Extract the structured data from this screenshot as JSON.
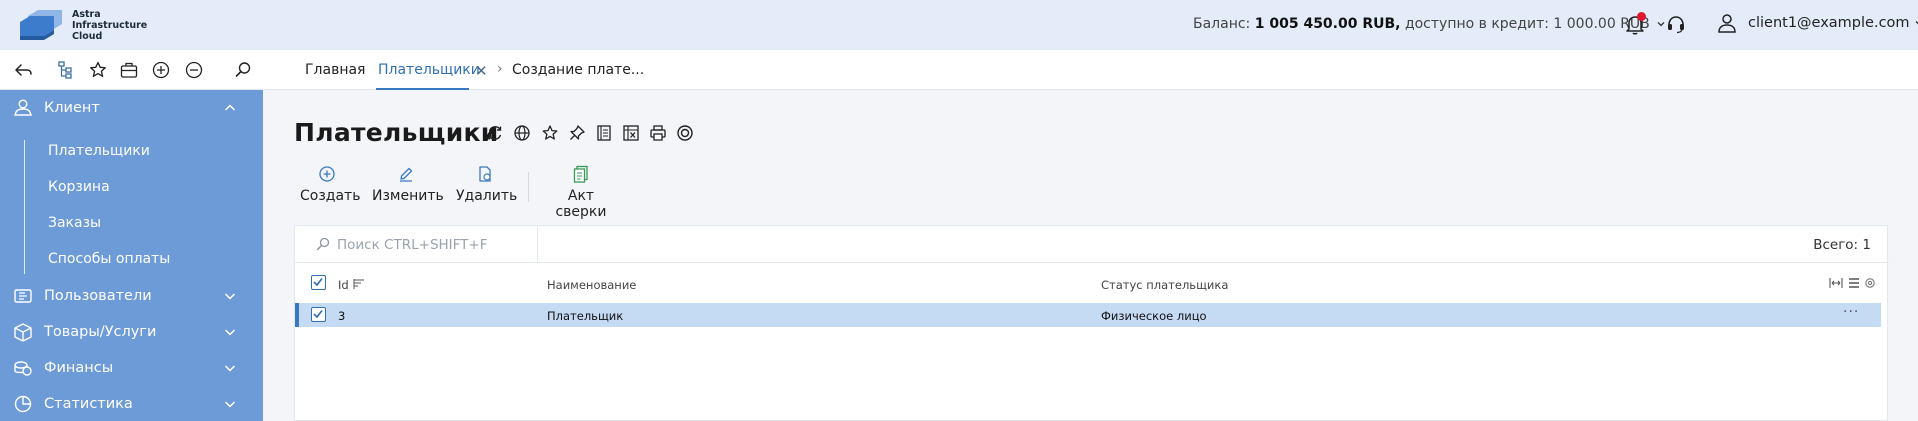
{
  "header": {
    "logo_lines": [
      "Astra",
      "Infrastructure",
      "Cloud"
    ],
    "balance_label": "Баланс:",
    "balance_value": "1 005 450.00 RUB,",
    "credit_label": "доступно в кредит:",
    "credit_value": "1 000.00 RUB",
    "user_email": "client1@example.com"
  },
  "toolbar": {
    "tabs": [
      {
        "label": "Главная"
      },
      {
        "label": "Плательщики"
      },
      {
        "label": "Создание плате..."
      }
    ],
    "tab_close": "✕",
    "tab_separator": "›"
  },
  "sidebar": {
    "sections": [
      {
        "label": "Клиент"
      },
      {
        "label": "Пользователи"
      },
      {
        "label": "Товары/Услуги"
      },
      {
        "label": "Финансы"
      },
      {
        "label": "Статистика"
      }
    ],
    "client_items": [
      {
        "label": "Плательщики"
      },
      {
        "label": "Корзина"
      },
      {
        "label": "Заказы"
      },
      {
        "label": "Способы оплаты"
      }
    ]
  },
  "main": {
    "title": "Плательщики",
    "actions": [
      {
        "label": "Создать"
      },
      {
        "label": "Изменить"
      },
      {
        "label": "Удалить"
      },
      {
        "label": "Акт сверки"
      }
    ],
    "search_placeholder": "Поиск CTRL+SHIFT+F",
    "total": "Всего: 1",
    "columns": [
      "Id",
      "Наименование",
      "Статус плательщика"
    ],
    "rows": [
      {
        "id": "3",
        "name": "Плательщик",
        "status": "Физическое лицо",
        "more": "···"
      }
    ]
  },
  "colors": {
    "header_bg": "#e3ecf8",
    "sidebar_bg": "#6d9bd8",
    "accent": "#2f6fb4",
    "selected_row": "#c5daf3",
    "notification_dot": "#e0182e"
  }
}
